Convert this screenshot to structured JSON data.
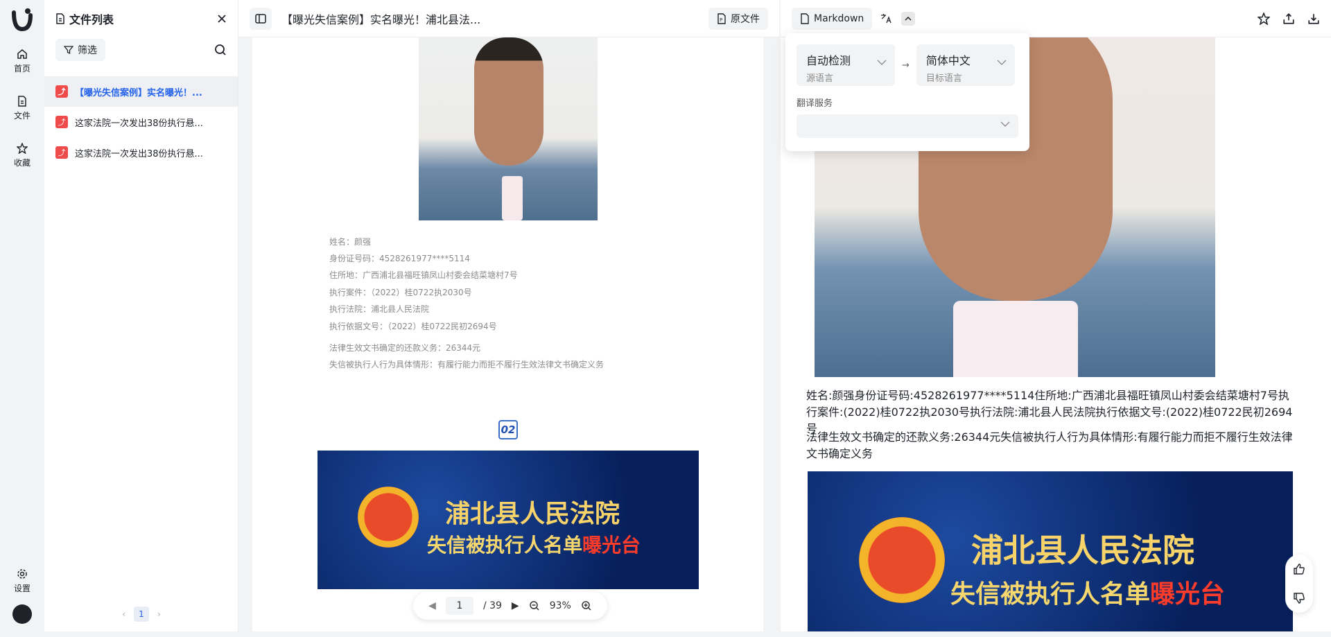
{
  "rail": {
    "items": [
      {
        "label": "首页"
      },
      {
        "label": "文件"
      },
      {
        "label": "收藏"
      }
    ],
    "settings_label": "设置"
  },
  "files": {
    "title": "文件列表",
    "filter_label": "筛选",
    "items": [
      {
        "name": "【曝光失信案例】实名曝光！..."
      },
      {
        "name": "这家法院一次发出38份执行悬..."
      },
      {
        "name": "这家法院一次发出38份执行悬..."
      }
    ],
    "page": "1"
  },
  "doc": {
    "title": "【曝光失信案例】实名曝光！浦北县法...",
    "original_label": "原文件",
    "info_lines": [
      "姓名：颜强",
      "身份证号码：4528261977****5114",
      "住所地：广西浦北县福旺镇凤山村委会结菜塘村7号",
      "执行案件：（2022）桂0722执2030号",
      "执行法院：浦北县人民法院",
      "执行依据文号：（2022）桂0722民初2694号"
    ],
    "info_lines2": [
      "法律生效文书确定的还款义务：26344元",
      "失信被执行人行为具体情形：有履行能力而拒不履行生效法律文书确定义务"
    ],
    "badge": "02",
    "banner_line1": "浦北县人民法院",
    "banner_line2a": "失信被执行人名单",
    "banner_line2b": "曝光台"
  },
  "zoom": {
    "page_current": "1",
    "page_total": "/ 39",
    "zoom_level": "93%"
  },
  "right": {
    "format_label": "Markdown",
    "para1": "姓名:颜强身份证号码:4528261977****5114住所地:广西浦北县福旺镇凤山村委会结菜塘村7号执行案件:(2022)桂0722执2030号执行法院:浦北县人民法院执行依据文号:(2022)桂0722民初2694号",
    "para2": "法律生效文书确定的还款义务:26344元失信被执行人行为具体情形:有履行能力而拒不履行生效法律文书确定义务"
  },
  "translate": {
    "source_value": "自动检测",
    "source_label": "源语言",
    "target_value": "简体中文",
    "target_label": "目标语言",
    "service_label": "翻译服务",
    "service_value": ""
  }
}
